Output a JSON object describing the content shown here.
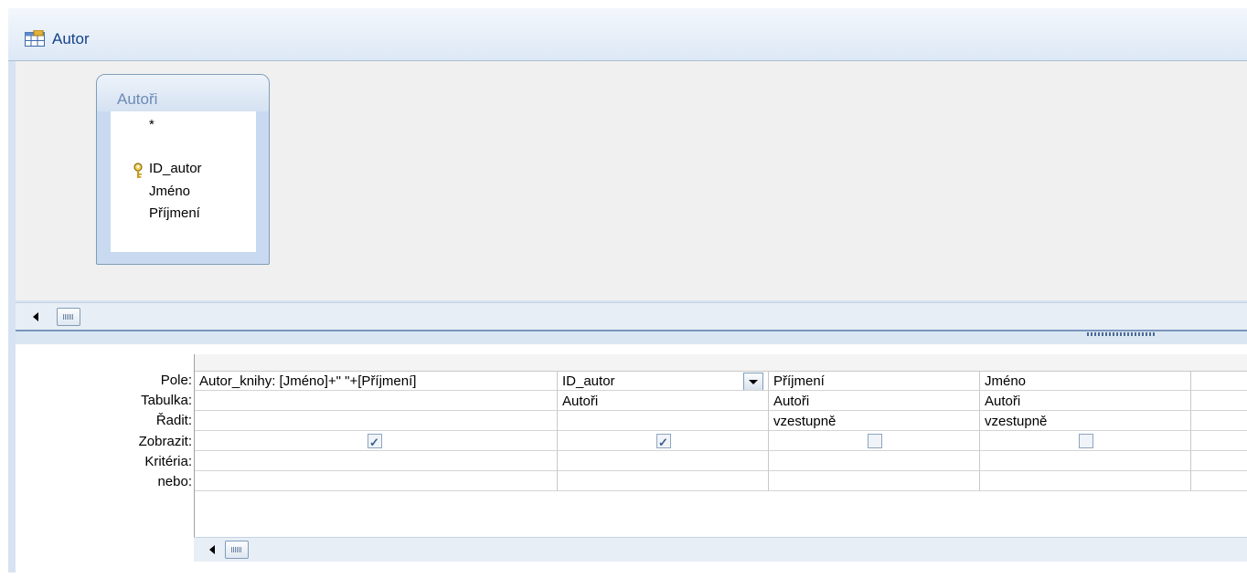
{
  "window": {
    "title": "Autor"
  },
  "table": {
    "name": "Autoři",
    "fields": [
      "*",
      "ID_autor",
      "Jméno",
      "Příjmení"
    ],
    "primary_key": "ID_autor"
  },
  "grid": {
    "row_labels": [
      "Pole:",
      "Tabulka:",
      "Řadit:",
      "Zobrazit:",
      "Kritéria:",
      "nebo:"
    ],
    "columns": [
      {
        "field": "Autor_knihy: [Jméno]+\" \"+[Příjmení]",
        "table": "",
        "sort": "",
        "show": true,
        "criteria": "",
        "or": ""
      },
      {
        "field": "ID_autor",
        "table": "Autoři",
        "sort": "",
        "show": true,
        "criteria": "",
        "or": ""
      },
      {
        "field": "Příjmení",
        "table": "Autoři",
        "sort": "vzestupně",
        "show": false,
        "criteria": "",
        "or": ""
      },
      {
        "field": "Jméno",
        "table": "Autoři",
        "sort": "vzestupně",
        "show": false,
        "criteria": "",
        "or": ""
      },
      {
        "field": "",
        "table": "",
        "sort": "",
        "show": null,
        "criteria": "",
        "or": ""
      }
    ]
  }
}
